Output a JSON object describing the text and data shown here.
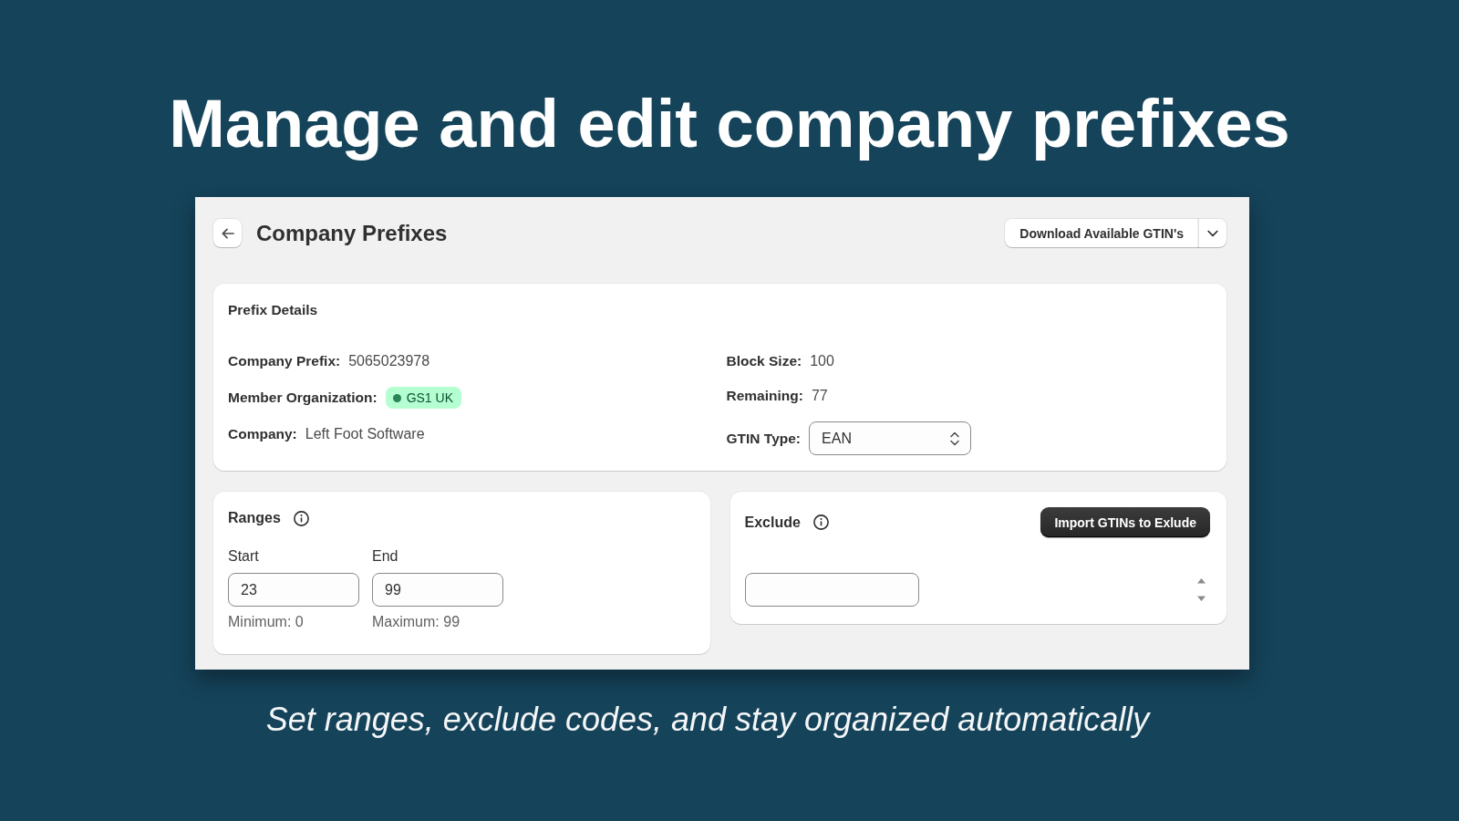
{
  "headline": "Manage and edit company prefixes",
  "app": {
    "header": {
      "title": "Company Prefixes",
      "download_button": "Download Available GTIN's"
    },
    "prefix_details": {
      "title": "Prefix Details",
      "columns": [
        {
          "fields": [
            {
              "kind": "text",
              "label": "Company Prefix:",
              "value": "5065023978"
            },
            {
              "kind": "badge",
              "label": "Member Organization:",
              "value": "GS1 UK"
            },
            {
              "kind": "text",
              "label": "Company:",
              "value": "Left Foot Software"
            }
          ]
        },
        {
          "fields": [
            {
              "kind": "text",
              "label": "Block Size:",
              "value": "100"
            },
            {
              "kind": "text",
              "label": "Remaining:",
              "value": "77"
            },
            {
              "kind": "select",
              "label": "GTIN Type:",
              "value": "EAN"
            }
          ]
        }
      ]
    },
    "ranges": {
      "title": "Ranges",
      "fields": [
        {
          "label": "Start",
          "value": "23",
          "help": "Minimum: 0"
        },
        {
          "label": "End",
          "value": "99",
          "help": "Maximum: 99"
        }
      ]
    },
    "exclude": {
      "title": "Exclude",
      "import_button": "Import GTINs to Exlude"
    }
  },
  "caption": "Set ranges, exclude codes, and stay organized automatically"
}
